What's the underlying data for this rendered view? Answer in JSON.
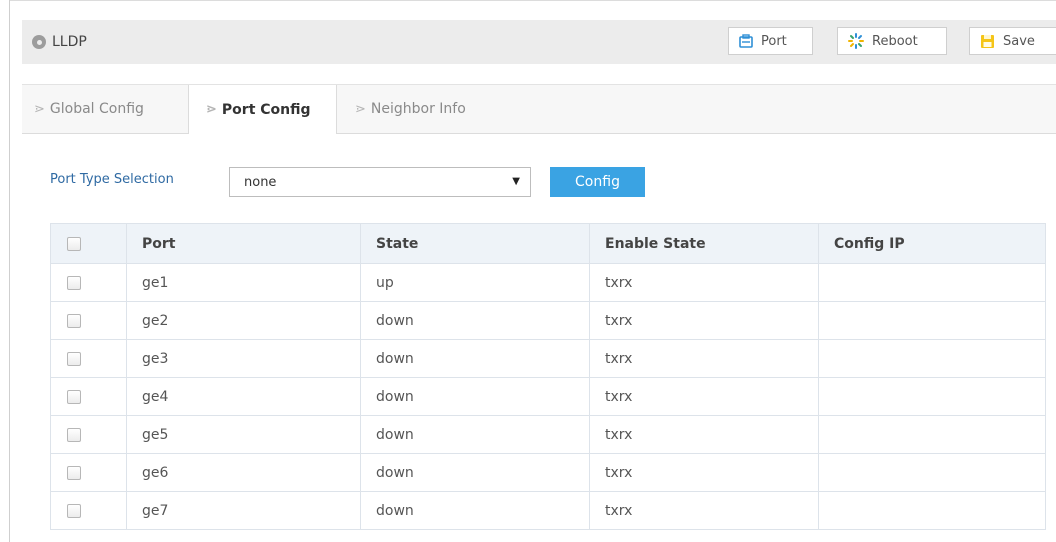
{
  "header": {
    "title": "LLDP",
    "buttons": {
      "port": "Port",
      "reboot": "Reboot",
      "save": "Save"
    }
  },
  "tabs": [
    {
      "label": "Global Config",
      "active": false
    },
    {
      "label": "Port Config",
      "active": true
    },
    {
      "label": "Neighbor Info",
      "active": false
    }
  ],
  "port_type": {
    "label": "Port Type Selection",
    "selected": "none",
    "button": "Config"
  },
  "table": {
    "columns": [
      "Port",
      "State",
      "Enable State",
      "Config IP"
    ],
    "rows": [
      {
        "port": "ge1",
        "state": "up",
        "enable_state": "txrx",
        "config_ip": ""
      },
      {
        "port": "ge2",
        "state": "down",
        "enable_state": "txrx",
        "config_ip": ""
      },
      {
        "port": "ge3",
        "state": "down",
        "enable_state": "txrx",
        "config_ip": ""
      },
      {
        "port": "ge4",
        "state": "down",
        "enable_state": "txrx",
        "config_ip": ""
      },
      {
        "port": "ge5",
        "state": "down",
        "enable_state": "txrx",
        "config_ip": ""
      },
      {
        "port": "ge6",
        "state": "down",
        "enable_state": "txrx",
        "config_ip": ""
      },
      {
        "port": "ge7",
        "state": "down",
        "enable_state": "txrx",
        "config_ip": ""
      }
    ]
  },
  "colors": {
    "accent": "#3aa3e3",
    "label_blue": "#2f6aa3",
    "header_bg": "#ececec",
    "table_header_bg": "#eef3f8"
  },
  "icons": {
    "header": "location-dot-icon",
    "port": "port-icon",
    "reboot": "reboot-spinner-icon",
    "save": "save-icon",
    "tab": "chevron-right-icon",
    "select": "triangle-down-icon"
  }
}
